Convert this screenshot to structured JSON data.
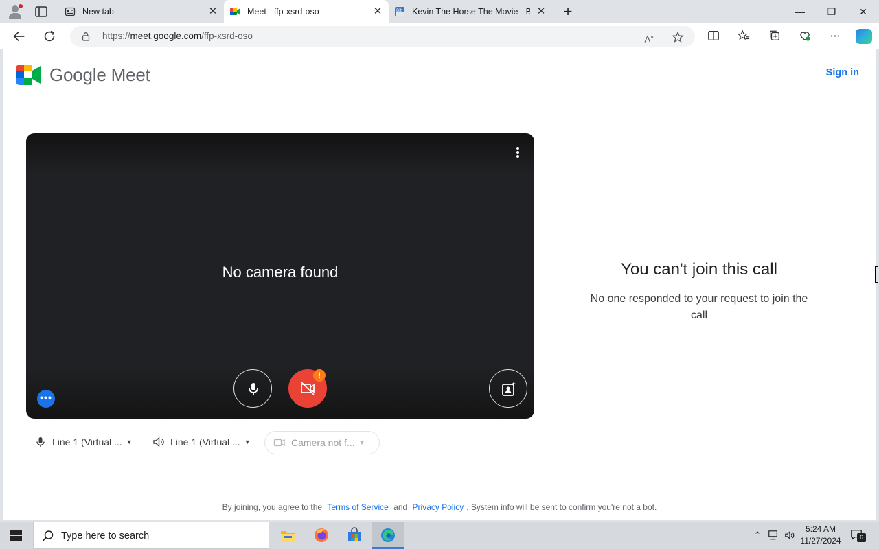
{
  "browser": {
    "tabs": [
      {
        "title": "New tab",
        "icon": "new-tab-page-icon",
        "active": false
      },
      {
        "title": "Meet - ffp-xsrd-oso",
        "icon": "google-meet-icon",
        "active": true
      },
      {
        "title": "Kevin The Horse The Movie - BitV",
        "icon": "bitview-icon",
        "active": false
      }
    ],
    "close_glyph": "✕",
    "new_tab_glyph": "+",
    "window_controls": {
      "minimize": "—",
      "restore": "❐",
      "close": "✕"
    },
    "address": {
      "scheme": "https://",
      "host": "meet.google.com",
      "path": "/ffp-xsrd-oso"
    }
  },
  "meet": {
    "brand_word": "Google Meet",
    "sign_in": "Sign in",
    "preview": {
      "message": "No camera found",
      "more_dots": "•••",
      "camera_warning_glyph": "!"
    },
    "devices": {
      "microphone": "Line 1 (Virtual ...",
      "speaker": "Line 1 (Virtual ...",
      "camera": "Camera not f...",
      "caret": "▼"
    },
    "status": {
      "title": "You can't join this call",
      "subtitle": "No one responded to your request to join the call"
    },
    "footer": {
      "prefix": "By joining, you agree to the",
      "terms": "Terms of Service",
      "and": "and",
      "privacy": "Privacy Policy",
      "suffix": ". System info will be sent to confirm you're not a bot."
    },
    "colors": {
      "accent": "#1a73e8",
      "camera_off": "#ea4335",
      "warning": "#fa7b17",
      "preview_bg": "#202124"
    }
  },
  "taskbar": {
    "search_placeholder": "Type here to search",
    "apps": [
      "file-explorer-icon",
      "firefox-icon",
      "microsoft-store-icon",
      "edge-icon"
    ],
    "time": "5:24 AM",
    "date": "11/27/2024",
    "notification_count": "6"
  }
}
